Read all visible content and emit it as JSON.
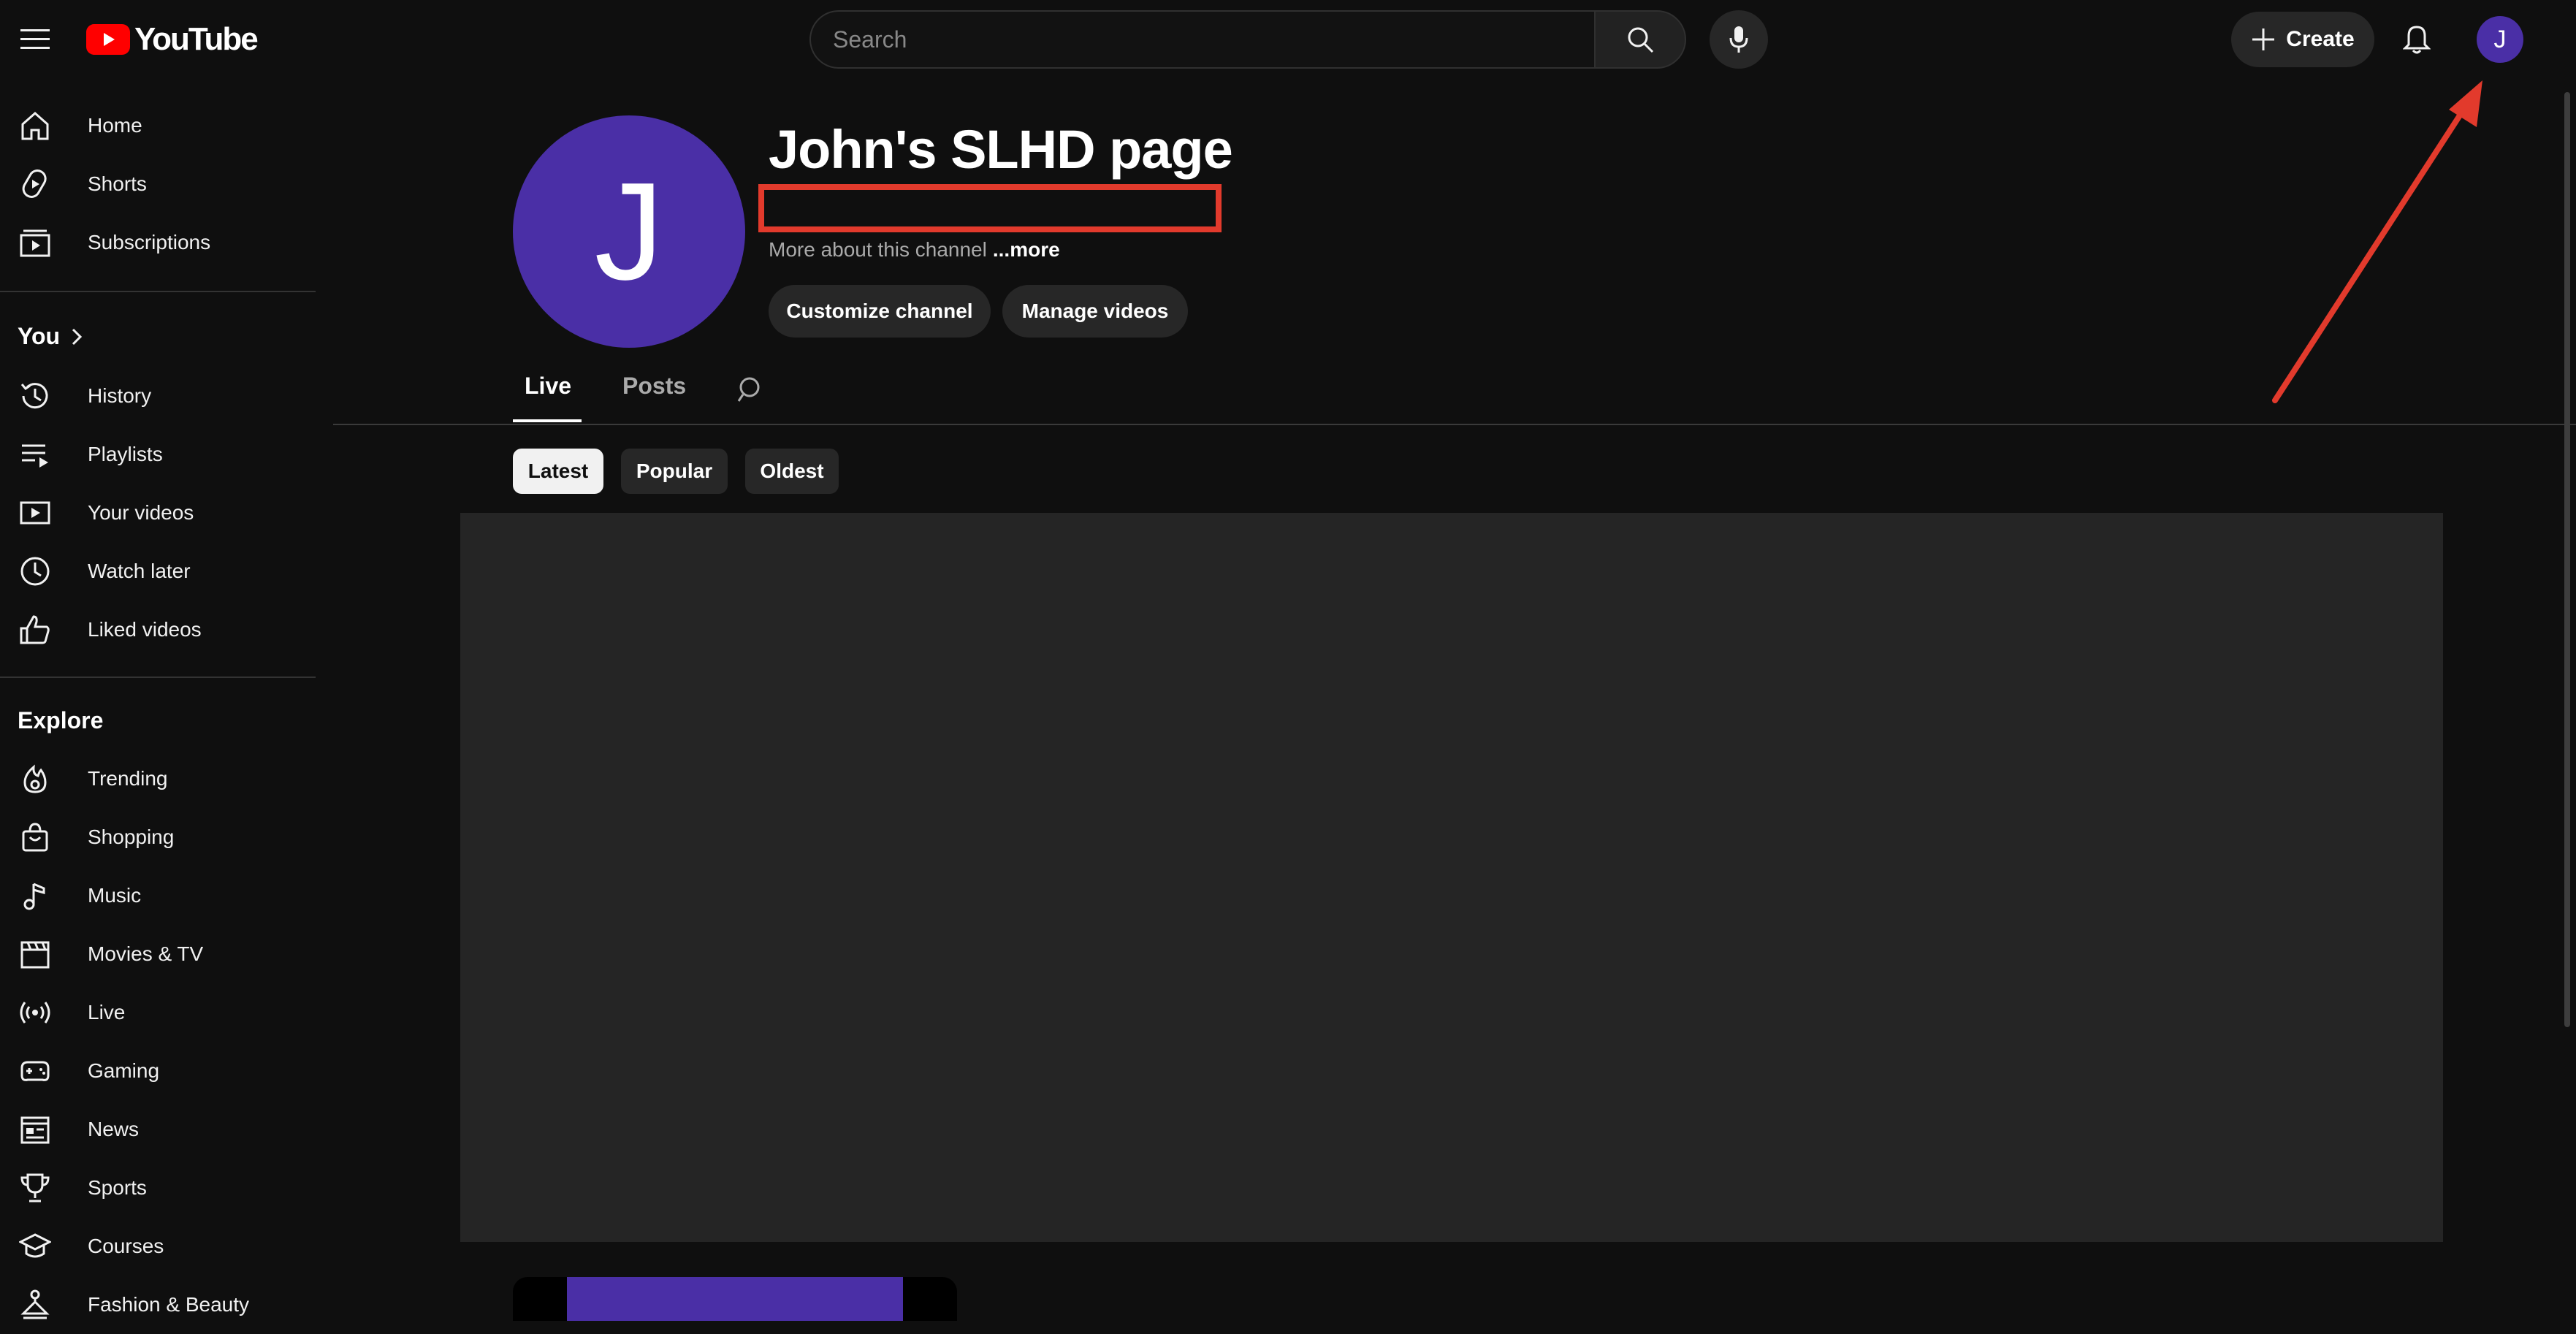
{
  "header": {
    "logo_text": "YouTube",
    "search_placeholder": "Search",
    "create_label": "Create",
    "avatar_initial": "J"
  },
  "sidebar": {
    "main": [
      {
        "label": "Home",
        "icon": "home-icon"
      },
      {
        "label": "Shorts",
        "icon": "shorts-icon"
      },
      {
        "label": "Subscriptions",
        "icon": "subscriptions-icon"
      }
    ],
    "you_heading": "You",
    "you": [
      {
        "label": "History",
        "icon": "history-icon"
      },
      {
        "label": "Playlists",
        "icon": "playlists-icon"
      },
      {
        "label": "Your videos",
        "icon": "your-videos-icon"
      },
      {
        "label": "Watch later",
        "icon": "watch-later-icon"
      },
      {
        "label": "Liked videos",
        "icon": "liked-videos-icon"
      }
    ],
    "explore_heading": "Explore",
    "explore": [
      {
        "label": "Trending",
        "icon": "trending-icon"
      },
      {
        "label": "Shopping",
        "icon": "shopping-icon"
      },
      {
        "label": "Music",
        "icon": "music-icon"
      },
      {
        "label": "Movies & TV",
        "icon": "movies-icon"
      },
      {
        "label": "Live",
        "icon": "live-icon"
      },
      {
        "label": "Gaming",
        "icon": "gaming-icon"
      },
      {
        "label": "News",
        "icon": "news-icon"
      },
      {
        "label": "Sports",
        "icon": "sports-icon"
      },
      {
        "label": "Courses",
        "icon": "courses-icon"
      },
      {
        "label": "Fashion & Beauty",
        "icon": "fashion-icon"
      }
    ]
  },
  "channel": {
    "avatar_initial": "J",
    "title": "John's SLHD page",
    "description": "More about this channel",
    "more_label": "...more",
    "customize_label": "Customize channel",
    "manage_label": "Manage videos"
  },
  "tabs": [
    {
      "label": "Live",
      "active": true
    },
    {
      "label": "Posts",
      "active": false
    }
  ],
  "chips": [
    {
      "label": "Latest",
      "active": true
    },
    {
      "label": "Popular",
      "active": false
    },
    {
      "label": "Oldest",
      "active": false
    }
  ],
  "colors": {
    "background": "#0f0f0f",
    "avatar": "#4a2fa6",
    "brand_red": "#ff0000",
    "annotation_red": "#e23a2c"
  }
}
